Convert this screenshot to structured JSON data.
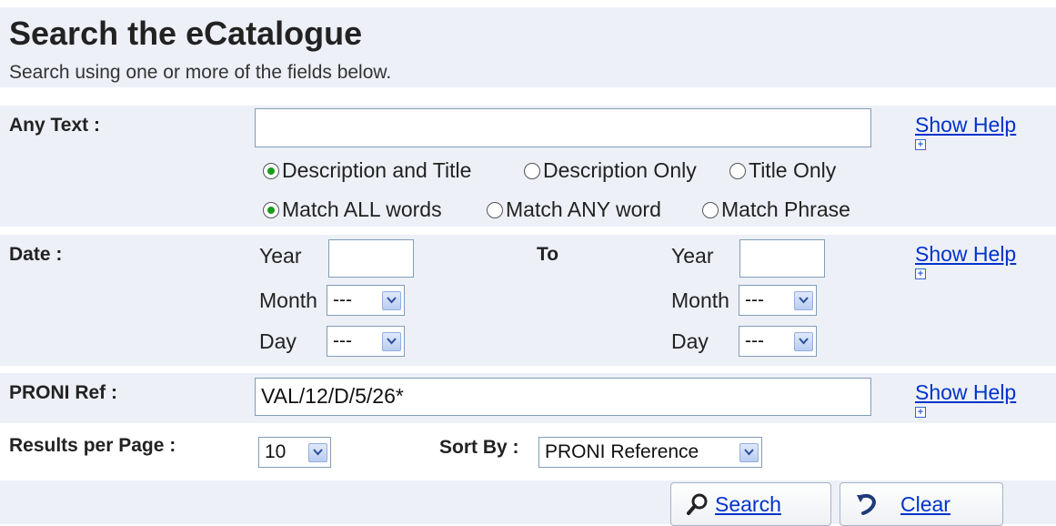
{
  "header": {
    "title": "Search the eCatalogue",
    "subtitle": "Search using one or more of the fields below."
  },
  "any_text": {
    "label": "Any Text :",
    "value": "",
    "scope_options": [
      "Description and Title",
      "Description Only",
      "Title Only"
    ],
    "scope_selected": "Description and Title",
    "match_options": [
      "Match ALL words",
      "Match ANY word",
      "Match Phrase"
    ],
    "match_selected": "Match ALL words",
    "help": "Show Help"
  },
  "date": {
    "label": "Date :",
    "to_label": "To",
    "year_label": "Year",
    "month_label": "Month",
    "day_label": "Day",
    "from": {
      "year": "",
      "month": "---",
      "day": "---"
    },
    "to": {
      "year": "",
      "month": "---",
      "day": "---"
    },
    "help": "Show Help"
  },
  "proni_ref": {
    "label": "PRONI Ref :",
    "value": "VAL/12/D/5/26*",
    "help": "Show Help"
  },
  "results": {
    "label": "Results per Page :",
    "per_page": "10",
    "sort_label": "Sort By :",
    "sort_value": "PRONI Reference"
  },
  "actions": {
    "search_label": "Search",
    "clear_label": "Clear"
  },
  "icons": {
    "search": "magnifier-icon",
    "clear": "undo-arrow-icon",
    "help": "expand-plus-icon",
    "dropdown": "chevron-down-icon"
  }
}
